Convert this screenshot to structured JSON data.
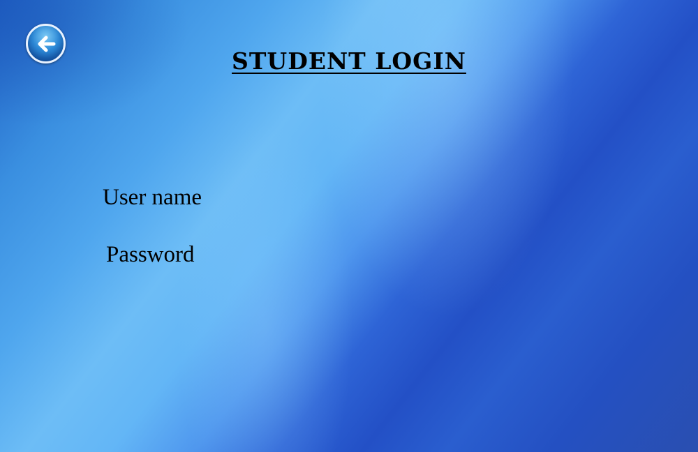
{
  "back_button": {
    "icon": "arrow-left-icon"
  },
  "page": {
    "title": "STUDENT LOGIN"
  },
  "form": {
    "username_label": "User name",
    "password_label": "Password"
  }
}
